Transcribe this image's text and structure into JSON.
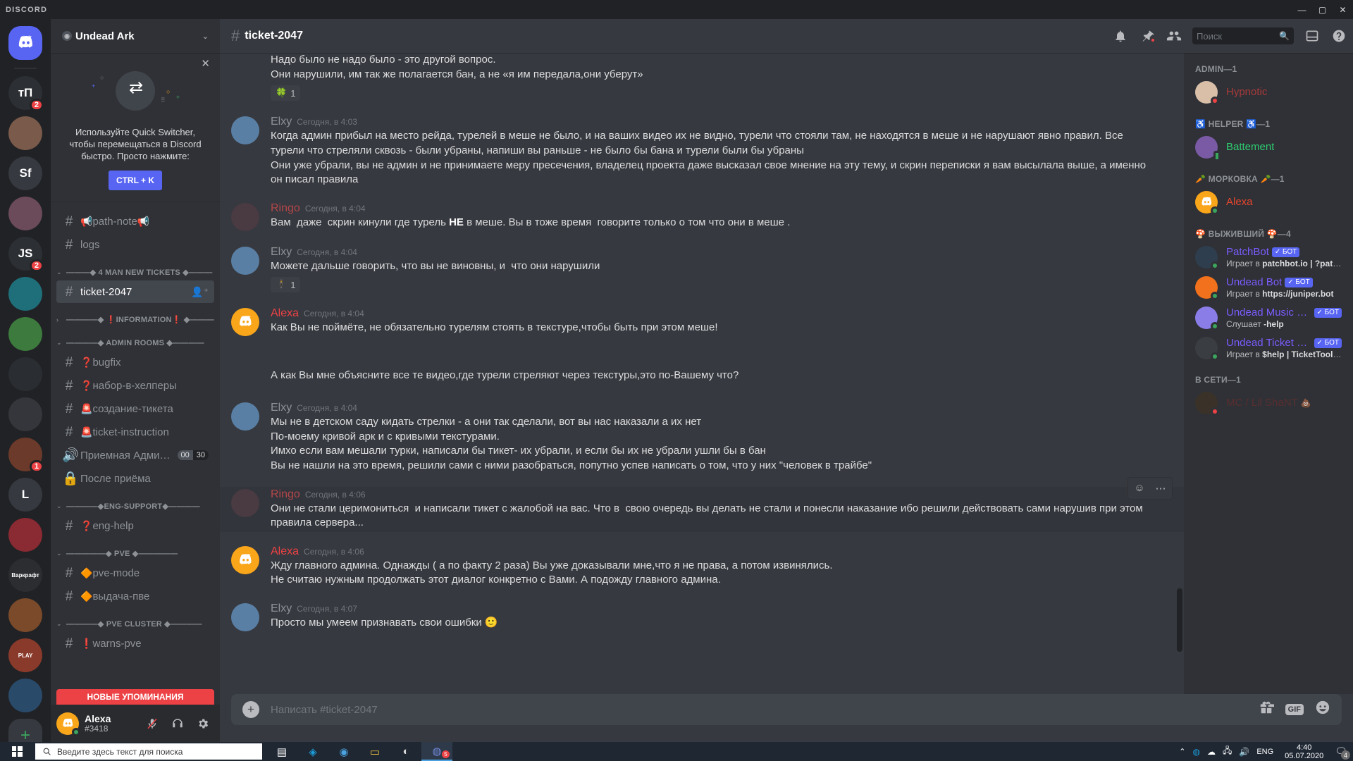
{
  "window": {
    "wordmark": "DISCORD",
    "minimize": "—",
    "maximize": "▢",
    "close": "✕"
  },
  "guild_rail": {
    "home_icon": "home-discord-icon",
    "items": [
      {
        "name": "guild-tn",
        "label": "тП",
        "color": "#2c2f33",
        "badge": "2"
      },
      {
        "name": "guild-photo",
        "label": "",
        "color": "#7a5a4a",
        "badge": ""
      },
      {
        "name": "guild-sf",
        "label": "Sf",
        "color": "#36393f",
        "badge": ""
      },
      {
        "name": "guild-pink",
        "label": "",
        "color": "#6b4a5a",
        "badge": ""
      },
      {
        "name": "guild-js",
        "label": "JS",
        "color": "#2c2f33",
        "badge": "2"
      },
      {
        "name": "guild-teal",
        "label": "",
        "color": "#1f6f7a",
        "badge": ""
      },
      {
        "name": "guild-green",
        "label": "",
        "color": "#3d7a3d",
        "badge": ""
      },
      {
        "name": "guild-dark",
        "label": "",
        "color": "#2a2d31",
        "badge": ""
      },
      {
        "name": "guild-diamond",
        "label": "",
        "color": "#34363b",
        "badge": ""
      },
      {
        "name": "guild-char",
        "label": "",
        "color": "#6b3a2a",
        "badge": "1"
      },
      {
        "name": "guild-l",
        "label": "L",
        "color": "#36393f",
        "badge": ""
      },
      {
        "name": "guild-red",
        "label": "",
        "color": "#8a2a32",
        "badge": ""
      },
      {
        "name": "guild-warcraft",
        "label": "Варкрафт",
        "color": "#2b2d31",
        "badge": ""
      },
      {
        "name": "guild-fire",
        "label": "",
        "color": "#7a4a2a",
        "badge": ""
      },
      {
        "name": "guild-play",
        "label": "PLAY",
        "color": "#8a3a2a",
        "badge": ""
      },
      {
        "name": "guild-swirl",
        "label": "",
        "color": "#2a4a6a",
        "badge": ""
      }
    ],
    "add_label": "+"
  },
  "sidebar": {
    "guild_name": "Undead Ark",
    "guild_verified_glyph": "◉",
    "chevron": "⌄",
    "quick_switcher": {
      "close": "✕",
      "text": "Используйте Quick Switcher, чтобы перемещаться в Discord быстро. Просто нажмите:",
      "key_label": "CTRL + K"
    },
    "new_mentions_label": "НОВЫЕ УПОМИНАНИЯ",
    "groups": [
      {
        "name": "",
        "arrow": "",
        "channels": [
          {
            "id": "path-note",
            "icon": "#",
            "emoji_before": "📢",
            "label": "path-note",
            "emoji_after": "📢",
            "type": "text",
            "active": false
          },
          {
            "id": "logs",
            "icon": "#",
            "emoji_before": "",
            "label": "logs",
            "emoji_after": "",
            "type": "text",
            "active": false
          }
        ]
      },
      {
        "name": "———◆ 4 MAN NEW TICKETS ◆———",
        "arrow": "⌄",
        "channels": [
          {
            "id": "ticket-2047",
            "icon": "#",
            "emoji_before": "",
            "label": "ticket-2047",
            "emoji_after": "",
            "type": "text-locked",
            "active": true,
            "right_icon": "add-member-icon"
          }
        ]
      },
      {
        "name": "————◆ ❗INFORMATION❗ ◆————",
        "arrow": "›",
        "channels": []
      },
      {
        "name": "————◆ ADMIN ROOMS ◆————",
        "arrow": "⌄",
        "channels": [
          {
            "id": "bugfix",
            "icon": "#",
            "emoji_before": "❓",
            "label": "bugfix",
            "emoji_after": "",
            "type": "text",
            "active": false
          },
          {
            "id": "nabor-v-helpery",
            "icon": "#",
            "emoji_before": "❓",
            "label": "набор-в-хелперы",
            "emoji_after": "",
            "type": "text",
            "active": false
          },
          {
            "id": "sozdanie-tiketa",
            "icon": "#",
            "emoji_before": "🚨",
            "label": "создание-тикета",
            "emoji_after": "",
            "type": "text",
            "active": false
          },
          {
            "id": "ticket-instruction",
            "icon": "#",
            "emoji_before": "🚨",
            "label": "ticket-instruction",
            "emoji_after": "",
            "type": "text",
            "active": false
          },
          {
            "id": "priemnaya-admi",
            "icon": "🔊",
            "emoji_before": "",
            "label": "Приемная Адми…",
            "emoji_after": "",
            "type": "voice",
            "active": false,
            "count_a": "00",
            "count_b": "30"
          },
          {
            "id": "posle-priema",
            "icon": "🔒",
            "emoji_before": "",
            "label": "После приёма",
            "emoji_after": "",
            "type": "locked",
            "active": false
          }
        ]
      },
      {
        "name": "————◆ENG-SUPPORT◆————",
        "arrow": "⌄",
        "channels": [
          {
            "id": "eng-help",
            "icon": "#",
            "emoji_before": "❓",
            "label": "eng-help",
            "emoji_after": "",
            "type": "text",
            "active": false
          }
        ]
      },
      {
        "name": "—————◆ PVE ◆—————",
        "arrow": "⌄",
        "channels": [
          {
            "id": "pve-mode",
            "icon": "#",
            "emoji_before": "🔶",
            "label": "pve-mode",
            "emoji_after": "",
            "type": "text",
            "active": false
          },
          {
            "id": "vydacha-pve",
            "icon": "#",
            "emoji_before": "🔶",
            "label": "выдача-пве",
            "emoji_after": "",
            "type": "text",
            "active": false
          }
        ]
      },
      {
        "name": "————◆ PVE CLUSTER ◆————",
        "arrow": "⌄",
        "channels": [
          {
            "id": "warns-pve",
            "icon": "#",
            "emoji_before": "❗",
            "label": "warns-pve",
            "emoji_after": "",
            "type": "text",
            "active": false
          }
        ]
      }
    ],
    "user_panel": {
      "name": "Alexa",
      "tag": "#3418",
      "status": "online",
      "mute_icon": "mic-muted-icon",
      "deafen_icon": "headphones-icon",
      "settings_icon": "gear-icon"
    }
  },
  "chat_header": {
    "hash": "#",
    "channel": "ticket-2047",
    "icons": [
      {
        "name": "bell-icon",
        "glyph": "🔔",
        "dot": false
      },
      {
        "name": "pin-icon",
        "glyph": "📌",
        "dot": true
      },
      {
        "name": "members-icon",
        "glyph": "👥",
        "dot": false
      }
    ],
    "search_placeholder": "Поиск",
    "search_value": "",
    "inbox_icon": "inbox-icon",
    "help_icon": "help-icon"
  },
  "messages": [
    {
      "id": "m1",
      "author": "",
      "author_color": "#ed4245",
      "time": "",
      "avatar_color": "#faa61a",
      "avatar_glyph": "",
      "continuation": true,
      "lines": [
        "Надо было не надо было - это другой вопрос.",
        "Они нарушили, им так же полагается бан, а не «я им передала,они уберут»"
      ],
      "reaction": {
        "emoji": "🍀",
        "count": "1"
      }
    },
    {
      "id": "m2",
      "author": "Elxy",
      "author_color": "#8e9297",
      "time": "Сегодня, в 4:03",
      "avatar_color": "#5a7fa5",
      "avatar_glyph": "",
      "continuation": false,
      "lines": [
        "Когда админ прибыл на место рейда, турелей в меше не было, и на ваших видео их не видно, турели что стояли там, не находятся в меше и не нарушают явно правил. Все турели что стреляли сквозь - были убраны, напиши вы раньше - не было бы бана и турели были бы убраны",
        "Они уже убрали, вы не админ и не принимаете меру пресечения, владелец проекта даже высказал свое мнение на эту тему, и скрин переписки я вам высылала выше, а именно он писал правила"
      ],
      "reaction": null
    },
    {
      "id": "m3",
      "author": "Ringo",
      "author_color": "#b3464a",
      "time": "Сегодня, в 4:04",
      "avatar_color": "#4a3a42",
      "avatar_glyph": "",
      "continuation": false,
      "lines_html": [
        "Вам  даже  скрин кинули где турель <b>НЕ</b> в меше. Вы в тоже время  говорите только о том что они в меше ."
      ],
      "reaction": null
    },
    {
      "id": "m4",
      "author": "Elxy",
      "author_color": "#8e9297",
      "time": "Сегодня, в 4:04",
      "avatar_color": "#5a7fa5",
      "avatar_glyph": "",
      "continuation": false,
      "lines": [
        "Можете дальше говорить, что вы не виновны, и  что они нарушили"
      ],
      "reaction": {
        "emoji": "🕴",
        "count": "1"
      }
    },
    {
      "id": "m5",
      "author": "Alexa",
      "author_color": "#ed4245",
      "time": "Сегодня, в 4:04",
      "avatar_color": "#faa61a",
      "avatar_glyph": "",
      "continuation": false,
      "lines": [
        "Как Вы не поймёте, не обязательно турелям стоять в текстуре,чтобы быть при этом меше!"
      ],
      "reaction": null
    },
    {
      "id": "m6",
      "author": "",
      "author_color": "",
      "time": "",
      "avatar_color": "#faa61a",
      "avatar_glyph": "",
      "continuation": true,
      "spacer": true,
      "lines": [
        "А как Вы мне объясните все те видео,где турели стреляют через текстуры,это по-Вашему что?"
      ],
      "reaction": null
    },
    {
      "id": "m7",
      "author": "Elxy",
      "author_color": "#8e9297",
      "time": "Сегодня, в 4:04",
      "avatar_color": "#5a7fa5",
      "avatar_glyph": "",
      "continuation": false,
      "lines": [
        "Мы не в детском саду кидать стрелки - а они так сделали, вот вы нас наказали а их нет",
        "По-моему кривой арк и с кривыми текстурами.",
        "Имхо если вам мешали турки, написали бы тикет- их убрали, и если бы их не убрали ушли бы в бан",
        "Вы не нашли на это время, решили сами с ними разобраться, попутно успев написать о том, что у них \"человек в трайбе\""
      ],
      "reaction": null
    },
    {
      "id": "m8",
      "author": "Ringo",
      "author_color": "#b3464a",
      "time": "Сегодня, в 4:06",
      "avatar_color": "#4a3a42",
      "avatar_glyph": "",
      "continuation": false,
      "hovered": true,
      "lines": [
        "Они не стали церимониться  и написали тикет с жалобой на вас. Что в  свою очередь вы делать не стали и понесли наказание ибо решили действовать сами нарушив при этом  правила сервера..."
      ],
      "reaction": null,
      "actions": [
        {
          "name": "add-reaction-icon",
          "glyph": "☺"
        },
        {
          "name": "more-options-icon",
          "glyph": "⋯"
        }
      ]
    },
    {
      "id": "m9",
      "author": "Alexa",
      "author_color": "#ed4245",
      "time": "Сегодня, в 4:06",
      "avatar_color": "#faa61a",
      "avatar_glyph": "",
      "continuation": false,
      "lines": [
        "Жду главного админа. Однажды ( а по факту 2 раза) Вы уже доказывали мне,что я не права, а потом извинялись.",
        "Не считаю нужным продолжать этот диалог конкретно с Вами. А подожду главного админа."
      ],
      "reaction": null
    },
    {
      "id": "m10",
      "author": "Elxy",
      "author_color": "#8e9297",
      "time": "Сегодня, в 4:07",
      "avatar_color": "#5a7fa5",
      "avatar_glyph": "",
      "continuation": false,
      "lines": [
        "Просто мы умеем признавать свои ошибки 🙂"
      ],
      "reaction": null
    }
  ],
  "composer": {
    "plus": "+",
    "placeholder": "Написать #ticket-2047",
    "gift_icon": "gift-icon",
    "gif_label": "GIF",
    "emoji_icon": "emoji-icon"
  },
  "members": {
    "groups": [
      {
        "label": "ADMIN—1",
        "people": [
          {
            "name": "Hypnotic",
            "color": "#a83a3a",
            "avatar_color": "#d9bfa8",
            "status": "dnd",
            "activity": "",
            "bot": false,
            "mobile": false
          }
        ]
      },
      {
        "label": "♿ HELPER ♿—1",
        "people": [
          {
            "name": "Battement",
            "color": "#2ecc71",
            "avatar_color": "#7a5aa5",
            "status": "mobile",
            "activity": "",
            "bot": false,
            "mobile": true
          }
        ]
      },
      {
        "label": "🥕 МОРКОВКА 🥕—1",
        "people": [
          {
            "name": "Alexa",
            "color": "#e8452e",
            "avatar_color": "#faa61a",
            "status": "online",
            "activity": "",
            "bot": false,
            "mobile": false
          }
        ]
      },
      {
        "label": "🍄 ВЫЖИВШИЙ 🍄—4",
        "people": [
          {
            "name": "PatchBot",
            "color": "#7c5cff",
            "avatar_color": "#2f3e4e",
            "status": "online",
            "activity_prefix": "Играет в ",
            "activity_bold": "patchbot.io | ?patch…",
            "bot": true,
            "bot_label": "БОТ",
            "mobile": false
          },
          {
            "name": "Undead Bot",
            "color": "#7c5cff",
            "avatar_color": "#f2711c",
            "status": "online",
            "activity_prefix": "Играет в ",
            "activity_bold": "https://juniper.bot",
            "bot": true,
            "bot_label": "БОТ",
            "mobile": false
          },
          {
            "name": "Undead Music B…",
            "color": "#7c5cff",
            "avatar_color": "#8a7de8",
            "status": "online",
            "activity_prefix": "Слушает ",
            "activity_bold": "-help",
            "bot": true,
            "bot_label": "БОТ",
            "mobile": false
          },
          {
            "name": "Undead Ticket B…",
            "color": "#7c5cff",
            "avatar_color": "#3a3d42",
            "status": "online",
            "activity_prefix": "Играет в ",
            "activity_bold": "$help | TicketTool.xy…",
            "bot": true,
            "bot_label": "БОТ",
            "mobile": false
          }
        ]
      },
      {
        "label": "В СЕТИ—1",
        "people": [
          {
            "name": "MC / Lil ShaNT",
            "color": "#7a2c2c",
            "avatar_color": "#3a3228",
            "status": "dnd",
            "activity": "",
            "bot": false,
            "mobile": false,
            "suffix_emoji": "💩",
            "dim": true
          }
        ]
      }
    ]
  },
  "taskbar": {
    "search_placeholder": "Введите здесь текст для поиска",
    "items": [
      {
        "name": "task-view-icon",
        "glyph": "▤",
        "active": false
      },
      {
        "name": "skype-icon",
        "glyph": "◈",
        "active": false
      },
      {
        "name": "chrome-icon",
        "glyph": "◉",
        "active": false
      },
      {
        "name": "file-explorer-icon",
        "glyph": "▭",
        "active": false
      },
      {
        "name": "opera-icon",
        "glyph": "◐",
        "active": false
      },
      {
        "name": "discord-taskbar-icon",
        "glyph": "◍",
        "active": true,
        "badge": "5"
      }
    ],
    "tray": {
      "chevron": "⌃",
      "icons": [
        "steam-tray-icon",
        "onedrive-icon",
        "network-icon",
        "volume-icon"
      ],
      "language": "ENG",
      "time": "4:40",
      "date": "05.07.2020",
      "notification_count": "4"
    }
  }
}
